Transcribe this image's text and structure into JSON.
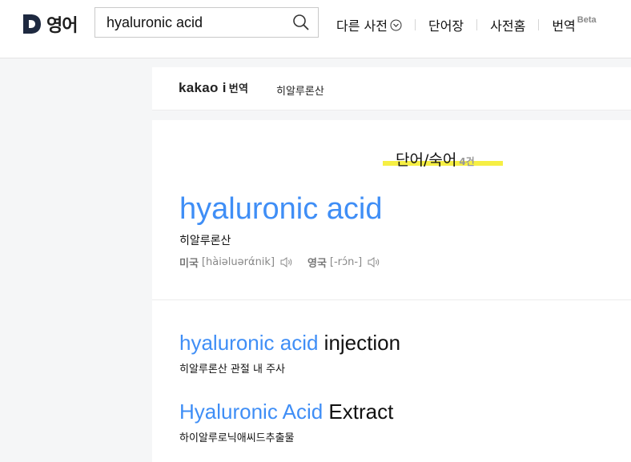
{
  "header": {
    "logo_letter": "D",
    "logo_text": "영어",
    "search_value": "hyaluronic acid",
    "search_placeholder": "",
    "nav": {
      "other_dict": "다른 사전",
      "wordbook": "단어장",
      "dict_home": "사전홈",
      "translate": "번역",
      "translate_badge": "Beta"
    }
  },
  "kakao_bar": {
    "brand": "kakao i",
    "brand_sub": "번역",
    "translation": "히알루론산"
  },
  "section": {
    "title": "단어/숙어",
    "count": "4건"
  },
  "main_entry": {
    "word": "hyaluronic acid",
    "meaning": "히알루론산",
    "pron_us_label": "미국",
    "pron_us": "[hàiəluərάnik]",
    "pron_uk_label": "영국",
    "pron_uk": "[-rɔ́n-]"
  },
  "sub_entries": [
    {
      "highlight": "hyaluronic acid",
      "rest": " injection",
      "meaning": "히알루론산 관절 내 주사"
    },
    {
      "highlight": "Hyaluronic Acid",
      "rest": " Extract",
      "meaning": "하이알루로닉애씨드추출물"
    }
  ],
  "colors": {
    "accent": "#3f8ef6",
    "highlight": "#f6ef44"
  },
  "icons": {
    "search": "search-icon",
    "chevron": "chevron-down-circle-icon",
    "speaker": "speaker-icon"
  }
}
